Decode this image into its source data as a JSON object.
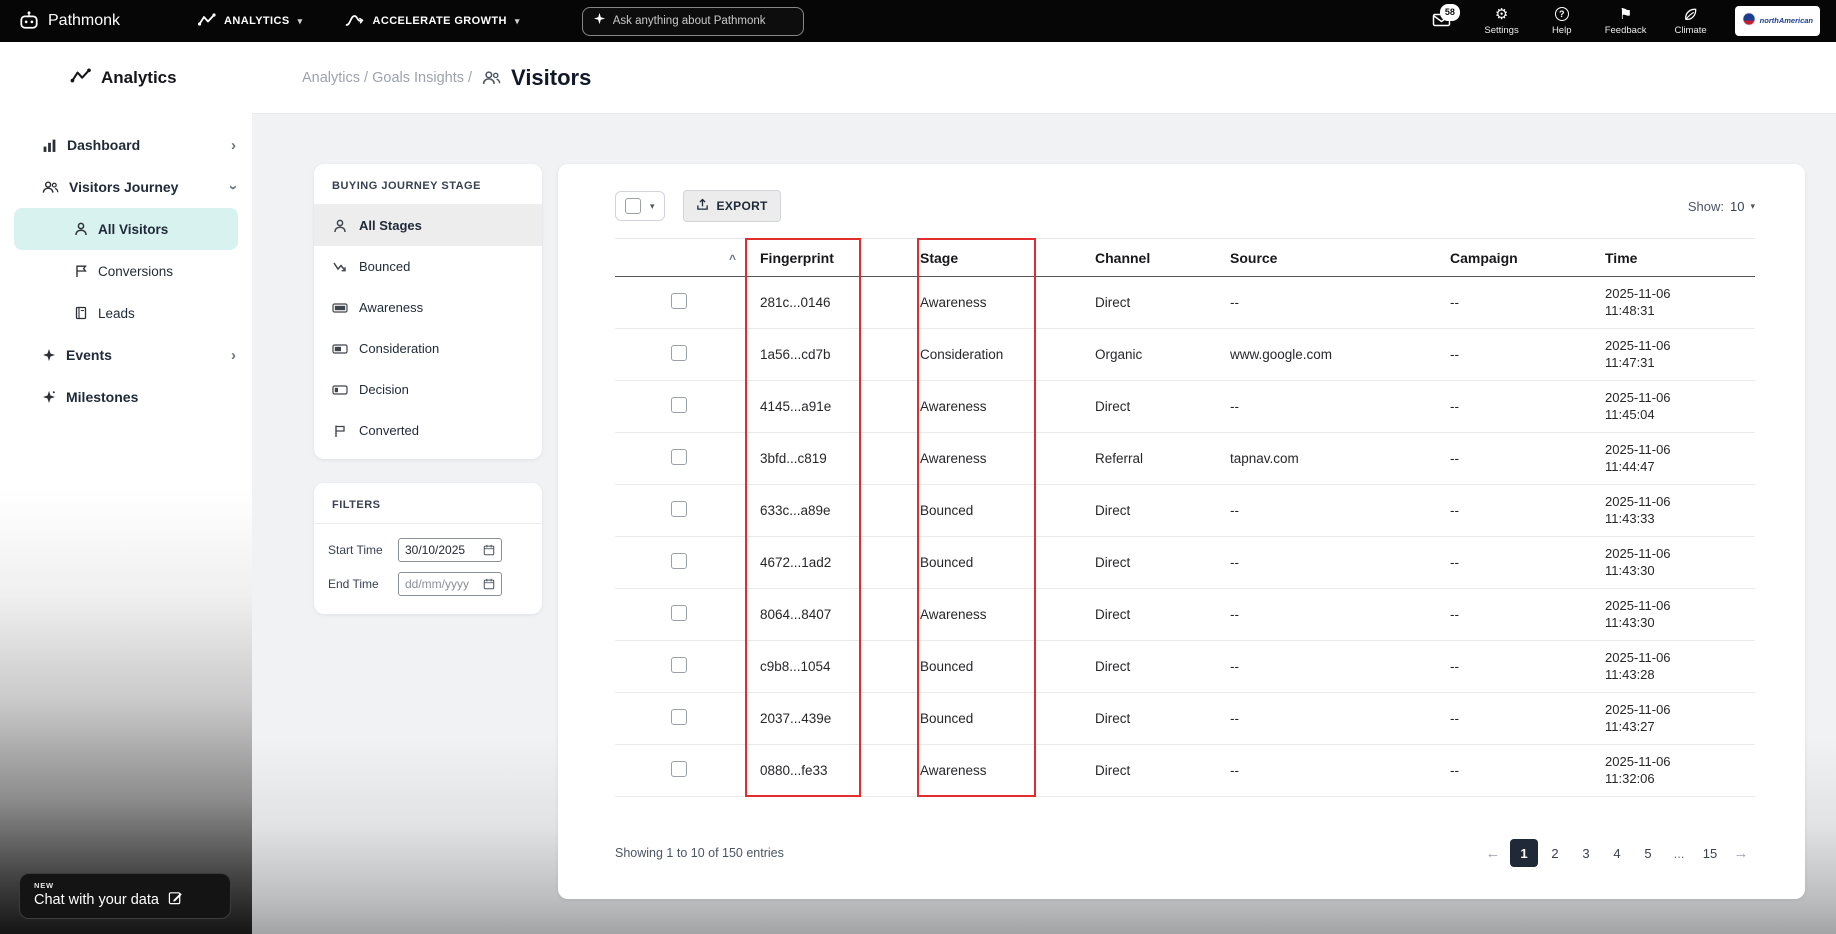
{
  "colors": {
    "topbar_bg": "#060606",
    "sidebar_active_bg": "#d7f2ef",
    "annotation_red": "#e12d2d",
    "pagination_active_bg": "#1f2937",
    "content_bg": "#f1f2f4",
    "card_bg": "#ffffff"
  },
  "topbar": {
    "brand": "Pathmonk",
    "menu_analytics": "ANALYTICS",
    "menu_growth": "ACCELERATE GROWTH",
    "search_placeholder": "Ask anything about Pathmonk",
    "notification_count": "58",
    "actions": [
      {
        "label": "Settings",
        "icon": "gear-icon"
      },
      {
        "label": "Help",
        "icon": "help-icon"
      },
      {
        "label": "Feedback",
        "icon": "feedback-flag-icon"
      },
      {
        "label": "Climate",
        "icon": "leaf-icon"
      }
    ],
    "partner_badge": "northAmerican"
  },
  "sidebar": {
    "title": "Analytics",
    "items": [
      {
        "label": "Dashboard",
        "icon": "bar-chart-icon",
        "chevron": "right"
      },
      {
        "label": "Visitors Journey",
        "icon": "people-icon",
        "chevron": "down"
      },
      {
        "label": "All Visitors",
        "icon": "person-icon",
        "active": true
      },
      {
        "label": "Conversions",
        "icon": "banner-flag-icon"
      },
      {
        "label": "Leads",
        "icon": "ledger-icon"
      },
      {
        "label": "Events",
        "icon": "sparkle-icon",
        "chevron": "right"
      },
      {
        "label": "Milestones",
        "icon": "sparkle-icon"
      }
    ],
    "chat_badge": "NEW",
    "chat_label": "Chat with your data"
  },
  "breadcrumb": {
    "path": "Analytics / Goals Insights /",
    "current": "Visitors"
  },
  "stages_panel": {
    "title": "BUYING JOURNEY STAGE",
    "items": [
      "All Stages",
      "Bounced",
      "Awareness",
      "Consideration",
      "Decision",
      "Converted"
    ]
  },
  "filters_panel": {
    "title": "FILTERS",
    "start_label": "Start Time",
    "start_value": "30/10/2025",
    "end_label": "End Time",
    "end_placeholder": "dd/mm/yyyy"
  },
  "table": {
    "export_label": "EXPORT",
    "show_label": "Show:",
    "show_value": "10",
    "sort_indicator": "^",
    "columns": [
      "Fingerprint",
      "Stage",
      "Channel",
      "Source",
      "Campaign",
      "Time"
    ],
    "rows": [
      {
        "fingerprint": "281c...0146",
        "stage": "Awareness",
        "channel": "Direct",
        "source": "--",
        "campaign": "--",
        "date": "2025-11-06",
        "time": "11:48:31"
      },
      {
        "fingerprint": "1a56...cd7b",
        "stage": "Consideration",
        "channel": "Organic",
        "source": "www.google.com",
        "campaign": "--",
        "date": "2025-11-06",
        "time": "11:47:31"
      },
      {
        "fingerprint": "4145...a91e",
        "stage": "Awareness",
        "channel": "Direct",
        "source": "--",
        "campaign": "--",
        "date": "2025-11-06",
        "time": "11:45:04"
      },
      {
        "fingerprint": "3bfd...c819",
        "stage": "Awareness",
        "channel": "Referral",
        "source": "tapnav.com",
        "campaign": "--",
        "date": "2025-11-06",
        "time": "11:44:47"
      },
      {
        "fingerprint": "633c...a89e",
        "stage": "Bounced",
        "channel": "Direct",
        "source": "--",
        "campaign": "--",
        "date": "2025-11-06",
        "time": "11:43:33"
      },
      {
        "fingerprint": "4672...1ad2",
        "stage": "Bounced",
        "channel": "Direct",
        "source": "--",
        "campaign": "--",
        "date": "2025-11-06",
        "time": "11:43:30"
      },
      {
        "fingerprint": "8064...8407",
        "stage": "Awareness",
        "channel": "Direct",
        "source": "--",
        "campaign": "--",
        "date": "2025-11-06",
        "time": "11:43:30"
      },
      {
        "fingerprint": "c9b8...1054",
        "stage": "Bounced",
        "channel": "Direct",
        "source": "--",
        "campaign": "--",
        "date": "2025-11-06",
        "time": "11:43:28"
      },
      {
        "fingerprint": "2037...439e",
        "stage": "Bounced",
        "channel": "Direct",
        "source": "--",
        "campaign": "--",
        "date": "2025-11-06",
        "time": "11:43:27"
      },
      {
        "fingerprint": "0880...fe33",
        "stage": "Awareness",
        "channel": "Direct",
        "source": "--",
        "campaign": "--",
        "date": "2025-11-06",
        "time": "11:32:06"
      }
    ],
    "footer": "Showing 1 to 10 of 150 entries",
    "pagination": [
      "1",
      "2",
      "3",
      "4",
      "5",
      "...",
      "15"
    ],
    "active_page": "1"
  }
}
